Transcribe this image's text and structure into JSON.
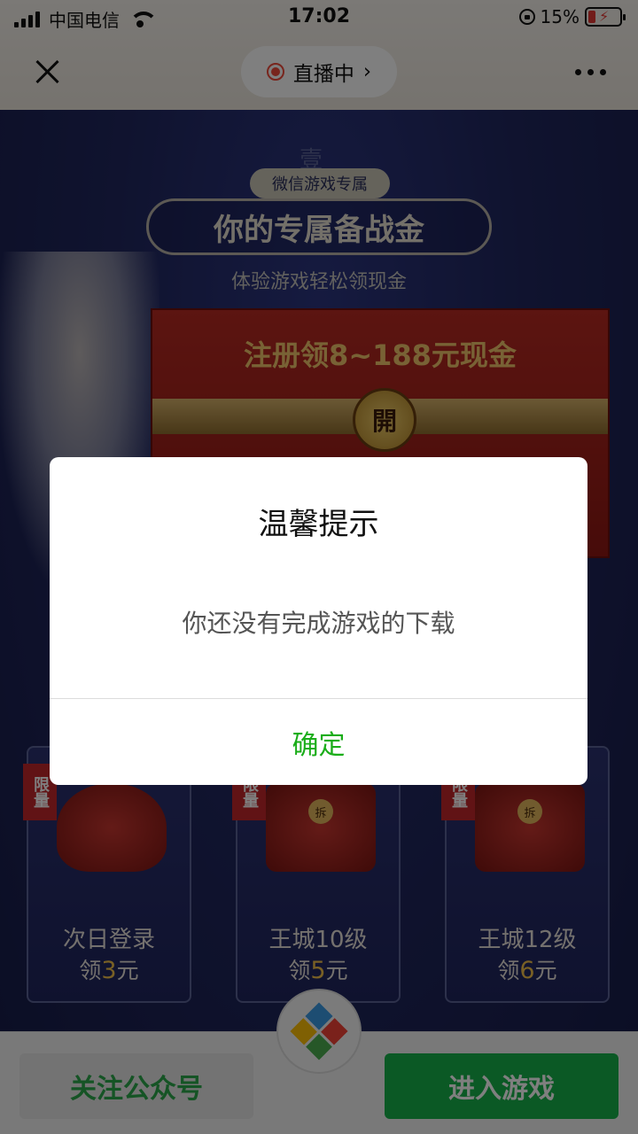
{
  "status_bar": {
    "carrier": "中国电信",
    "time": "17:02",
    "battery": "15%",
    "battery_level_fraction": 0.15,
    "icons": [
      "signal-icon",
      "wifi-icon",
      "rotation-lock-icon",
      "battery-charging-icon"
    ]
  },
  "nav": {
    "live_label": "直播中",
    "live_chevron": "›",
    "icons": [
      "close-icon",
      "live-dot-icon",
      "more-icon"
    ]
  },
  "game": {
    "ornament_char": "壹",
    "badge": "微信游戏专属",
    "title": "你的专属备战金",
    "subtitle": "体验游戏轻松领现金",
    "envelope_title": "注册领8~188元现金",
    "envelope_seal": "開",
    "cards": [
      {
        "tag": "限量",
        "line1": "次日登录",
        "line2_prefix": "领",
        "amount": "3",
        "line2_suffix": "元"
      },
      {
        "tag": "限量",
        "line1": "王城10级",
        "line2_prefix": "领",
        "amount": "5",
        "line2_suffix": "元",
        "seal": "拆"
      },
      {
        "tag": "限量",
        "line1": "王城12级",
        "line2_prefix": "领",
        "amount": "6",
        "line2_suffix": "元",
        "seal": "拆"
      }
    ]
  },
  "bottom": {
    "follow_label": "关注公众号",
    "enter_label": "进入游戏"
  },
  "dialog": {
    "title": "温馨提示",
    "message": "你还没有完成游戏的下载",
    "ok_label": "确定"
  },
  "colors": {
    "accent_green": "#1aad19",
    "live_red": "#f04b3b",
    "amount_gold": "#f2c04b"
  }
}
